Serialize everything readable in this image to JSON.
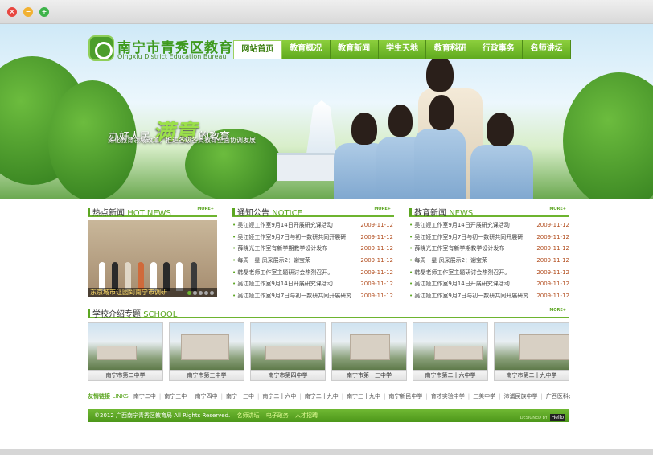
{
  "window": {
    "close": "×",
    "minimize": "−",
    "maximize": "+"
  },
  "site": {
    "title": "南宁市青秀区教育局",
    "subtitle": "Qingxiu District Education Bureau"
  },
  "nav": [
    "网站首页",
    "教育概况",
    "教育新闻",
    "学生天地",
    "教育科研",
    "行政事务",
    "名师讲坛"
  ],
  "banner": {
    "slogan_pre": "办好人民",
    "slogan_em": "满意",
    "slogan_post": "的教育",
    "sub": "深化教育领域改革，推进各级各类教育全面协调发展"
  },
  "hot_news": {
    "title": "热点新闻",
    "title_en": "HOT NEWS",
    "more": "MORE+",
    "caption": "东京城市让园到南宁市调研"
  },
  "notice": {
    "title": "通知公告",
    "title_en": "NOTICE",
    "more": "MORE+",
    "items": [
      {
        "t": "吴江娅工作室9月14日开展研究课活动",
        "d": "2009-11-12"
      },
      {
        "t": "吴江娅工作室9月7日与初一数研共同开展研",
        "d": "2009-11-12"
      },
      {
        "t": "薛晓光工作室有新学期教学设计发布",
        "d": "2009-11-12"
      },
      {
        "t": "每周一星 凤采展示2：谢宝荣",
        "d": "2009-11-12"
      },
      {
        "t": "韩磊老师工作室主题研讨会热烈召开。",
        "d": "2009-11-12"
      },
      {
        "t": "吴江娅工作室9月14日开展研究课活动",
        "d": "2009-11-12"
      },
      {
        "t": "吴江娅工作室9月7日与初一数研共同开展研究",
        "d": "2009-11-12"
      }
    ]
  },
  "edu_news": {
    "title": "教育新闻",
    "title_en": "NEWS",
    "more": "MORE+",
    "items": [
      {
        "t": "吴江娅工作室9月14日开展研究课活动",
        "d": "2009-11-12"
      },
      {
        "t": "吴江娅工作室9月7日与初一数研共同开展研",
        "d": "2009-11-12"
      },
      {
        "t": "薛晓光工作室有新学期教学设计发布",
        "d": "2009-11-12"
      },
      {
        "t": "每周一星 凤采展示2：谢宝荣",
        "d": "2009-11-12"
      },
      {
        "t": "韩磊老师工作室主题研讨会热烈召开。",
        "d": "2009-11-12"
      },
      {
        "t": "吴江娅工作室9月14日开展研究课活动",
        "d": "2009-11-12"
      },
      {
        "t": "吴江娅工作室9月7日与初一数研共同开展研究",
        "d": "2009-11-12"
      }
    ]
  },
  "schools": {
    "title": "学校介绍专题",
    "title_en": "SCHOOL",
    "more": "MORE+",
    "items": [
      "南宁市第二中学",
      "南宁市第三中学",
      "南宁市第四中学",
      "南宁市第十三中学",
      "南宁市第二十六中学",
      "南宁市第二十九中学"
    ]
  },
  "links": {
    "label": "友情链接",
    "label_en": "LINKS",
    "items": [
      "南宁二中",
      "南宁三中",
      "南宁四中",
      "南宁十三中",
      "南宁二十六中",
      "南宁二十九中",
      "南宁三十九中",
      "南宁新民中学",
      "育才实验中学",
      "三美中学",
      "沛浦民族中学",
      "广西医科大学附属"
    ]
  },
  "footer": {
    "copyright": "©2012 广西南宁青秀区教育局 All Rights Reserved.",
    "links": [
      "名师讲坛",
      "电子政务",
      "人才招聘"
    ],
    "design": "DESIGNED BY",
    "badge": "Hello"
  },
  "colors": {
    "brand_green": "#5ca622",
    "date_red": "#b24d1e"
  }
}
